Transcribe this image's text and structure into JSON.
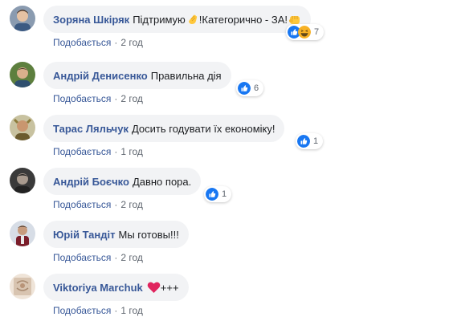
{
  "comments": [
    {
      "author": "Зоряна Шкіряк",
      "text": "Підтримую",
      "text_suffix": "!Категорично - ЗА!",
      "like_label": "Подобається",
      "separator": "·",
      "time": "2 год",
      "reactions": [
        "like",
        "haha"
      ],
      "reaction_count": "7",
      "emoji": [
        "hand-emoji",
        "fist-emoji"
      ]
    },
    {
      "author": "Андрій Денисенко",
      "text": "Правильна дія",
      "like_label": "Подобається",
      "separator": "·",
      "time": "2 год",
      "reactions": [
        "like"
      ],
      "reaction_count": "6"
    },
    {
      "author": "Тарас Ляльчук",
      "text": "Досить годувати їх економіку!",
      "like_label": "Подобається",
      "separator": "·",
      "time": "1 год",
      "reactions": [
        "like"
      ],
      "reaction_count": "1"
    },
    {
      "author": "Андрій Боєчко",
      "text": "Давно пора.",
      "like_label": "Подобається",
      "separator": "·",
      "time": "2 год",
      "reactions": [
        "like"
      ],
      "reaction_count": "1"
    },
    {
      "author": "Юрій Тандіт",
      "text": "Мы готовы!!!",
      "like_label": "Подобається",
      "separator": "·",
      "time": "2 год"
    },
    {
      "author": "Viktoriya Marchuk",
      "text": "+++",
      "like_label": "Подобається",
      "separator": "·",
      "time": "1 год",
      "emoji": [
        "heart-emoji"
      ]
    }
  ],
  "colors": {
    "author": "#385898",
    "bubble": "#f2f3f5",
    "meta": "#606770",
    "like_reaction": "#1877f2",
    "haha_reaction": "#f7b125",
    "heart": "#e0245e"
  }
}
